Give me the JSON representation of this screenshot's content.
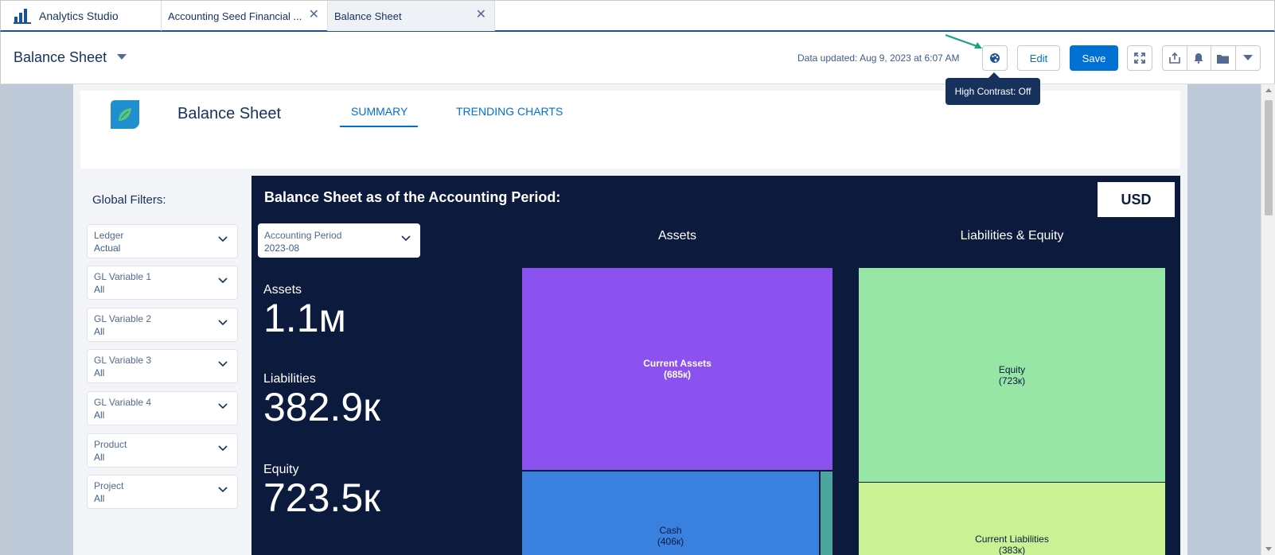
{
  "tabs": {
    "app_label": "Analytics Studio",
    "items": [
      {
        "label": "Accounting Seed Financial ..."
      },
      {
        "label": "Balance Sheet"
      }
    ]
  },
  "header": {
    "title": "Balance Sheet",
    "data_updated": "Data updated: Aug 9, 2023 at 6:07 AM",
    "edit_label": "Edit",
    "save_label": "Save",
    "tooltip": "High Contrast: Off"
  },
  "dashboard": {
    "title": "Balance Sheet",
    "nav": [
      {
        "label": "SUMMARY"
      },
      {
        "label": "TRENDING CHARTS"
      }
    ]
  },
  "filters": {
    "title": "Global Filters:",
    "items": [
      {
        "label": "Ledger",
        "value": "Actual"
      },
      {
        "label": "GL Variable 1",
        "value": "All"
      },
      {
        "label": "GL Variable 2",
        "value": "All"
      },
      {
        "label": "GL Variable 3",
        "value": "All"
      },
      {
        "label": "GL Variable 4",
        "value": "All"
      },
      {
        "label": "Product",
        "value": "All"
      },
      {
        "label": "Project",
        "value": "All"
      }
    ]
  },
  "panel": {
    "title": "Balance Sheet as of the Accounting Period:",
    "currency": "USD",
    "period_label": "Accounting Period",
    "period_value": "2023-08",
    "metrics": [
      {
        "label": "Assets",
        "value": "1.1м"
      },
      {
        "label": "Liabilities",
        "value": "382.9к"
      },
      {
        "label": "Equity",
        "value": "723.5к"
      }
    ]
  },
  "chart_data": [
    {
      "type": "treemap",
      "title": "Assets",
      "items": [
        {
          "name": "Current Assets",
          "label": "(685к)",
          "color": "#8c52ef"
        },
        {
          "name": "Cash",
          "label": "(406к)",
          "color": "#3a80df"
        },
        {
          "name": "",
          "label": "",
          "color": "#4aa79e"
        }
      ]
    },
    {
      "type": "treemap",
      "title": "Liabilities & Equity",
      "items": [
        {
          "name": "Equity",
          "label": "(723к)",
          "color": "#97e6a6"
        },
        {
          "name": "Current Liabilities",
          "label": "(383к)",
          "color": "#caf194"
        }
      ]
    }
  ],
  "colors": {
    "brand": "#0070d2",
    "panel_bg": "#0b1a3d",
    "header_text": "#16325c"
  }
}
